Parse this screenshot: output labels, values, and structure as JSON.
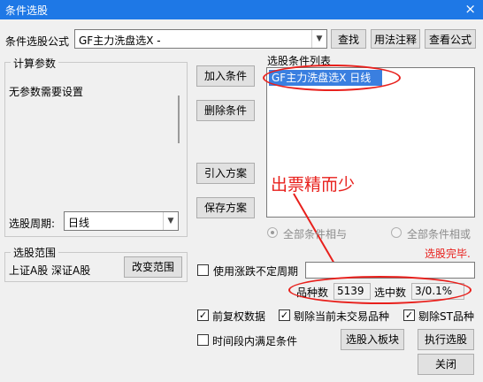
{
  "window": {
    "title": "条件选股",
    "close_glyph": "×"
  },
  "formula": {
    "label": "条件选股公式",
    "value": "GF主力洗盘选X  -",
    "btn_find": "查找",
    "btn_usage": "用法注释",
    "btn_view": "查看公式"
  },
  "params": {
    "group_title": "计算参数",
    "empty_text": "无参数需要设置",
    "period_label": "选股周期:",
    "period_value": "日线"
  },
  "condition_buttons": {
    "add": "加入条件",
    "delete": "删除条件",
    "import": "引入方案",
    "save": "保存方案"
  },
  "condition_list": {
    "title": "选股条件列表",
    "items": [
      "GF主力洗盘选X  日线"
    ]
  },
  "logic": {
    "all_and": "全部条件相与",
    "all_or": "全部条件相或"
  },
  "status_text": "选股完毕.",
  "annotation_text": "出票精而少",
  "range": {
    "group_title": "选股范围",
    "value": "上证A股 深证A股",
    "change_btn": "改变范围"
  },
  "options": {
    "use_variable_period": "使用涨跌不定周期",
    "forward_adjust": "前复权数据",
    "exclude_not_traded": "剔除当前未交易品种",
    "exclude_st": "剔除ST品种",
    "time_range": "时间段内满足条件"
  },
  "stats": {
    "count_label": "品种数",
    "count_value": "5139",
    "selected_label": "选中数",
    "selected_value": "3/0.1%"
  },
  "actions": {
    "to_block": "选股入板块",
    "execute": "执行选股",
    "close": "关闭"
  },
  "colors": {
    "titlebar": "#1e78e6",
    "selection": "#3a7fe0",
    "annotation": "#e8201c"
  },
  "check_glyph": "✓",
  "arrow_glyph": "▼"
}
